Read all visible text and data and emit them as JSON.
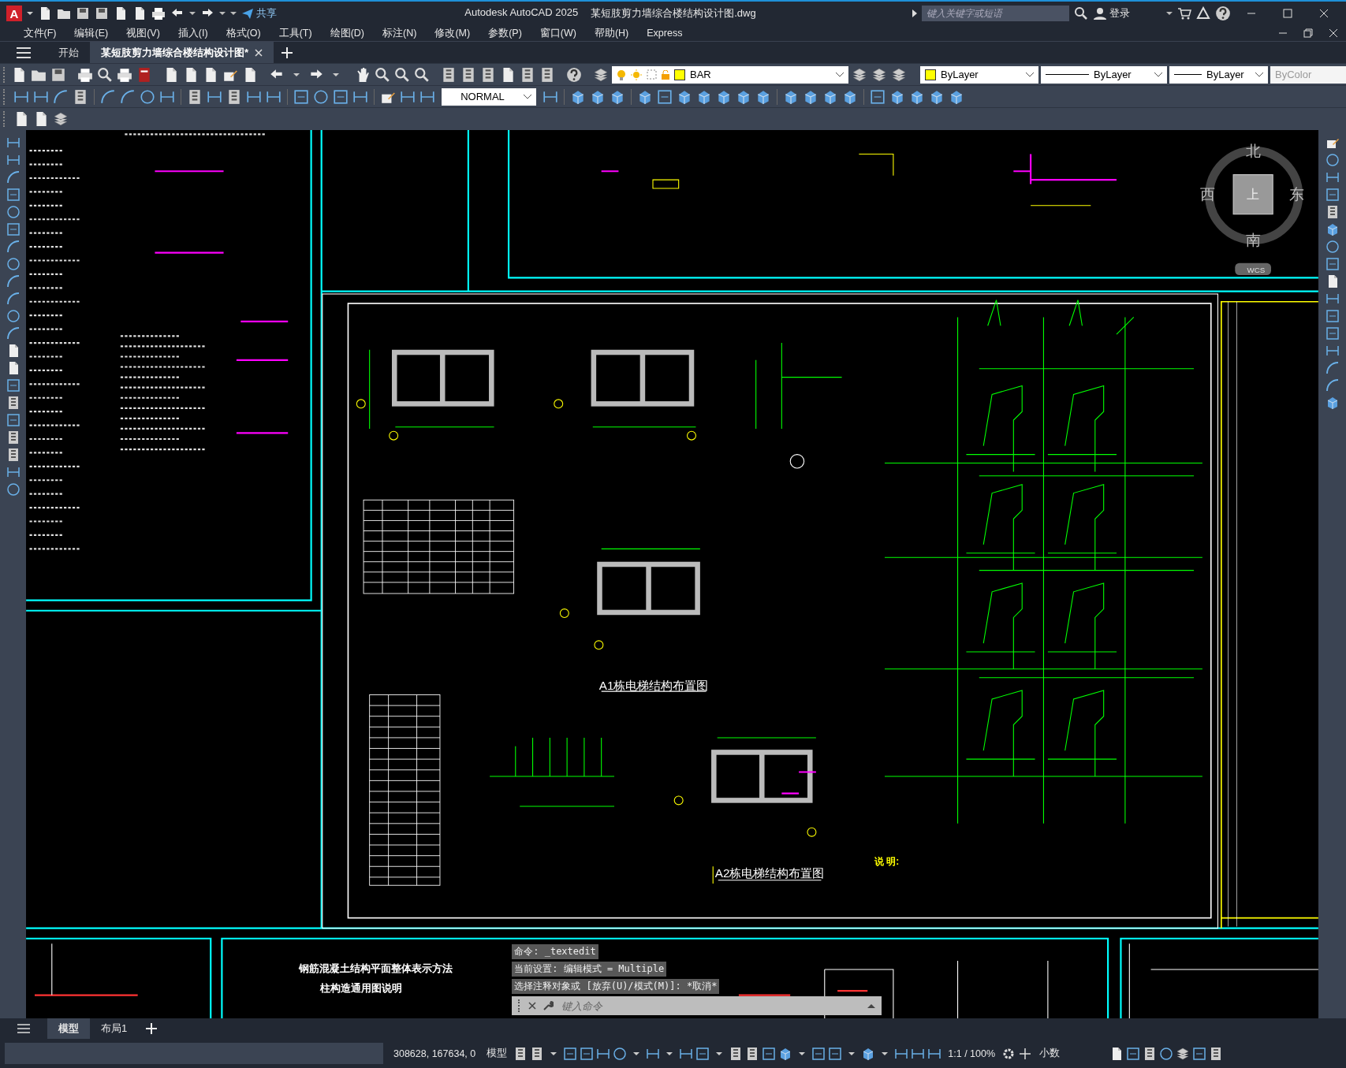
{
  "title_bar": {
    "logo": "A",
    "share": "共享",
    "app_name": "Autodesk AutoCAD 2025",
    "file_name": "某短肢剪力墙综合楼结构设计图.dwg",
    "search": {
      "placeholder": "键入关键字或短语"
    },
    "sign_in": "登录"
  },
  "menu": [
    "文件(F)",
    "编辑(E)",
    "视图(V)",
    "插入(I)",
    "格式(O)",
    "工具(T)",
    "绘图(D)",
    "标注(N)",
    "修改(M)",
    "参数(P)",
    "窗口(W)",
    "帮助(H)",
    "Express"
  ],
  "file_tabs": [
    {
      "label": "开始",
      "selected": false
    },
    {
      "label": "某短肢剪力墙综合楼结构设计图*",
      "selected": true
    }
  ],
  "toolbar": {
    "layer": "BAR",
    "dim_style": "NORMAL",
    "object_color": "ByLayer",
    "linetype": "ByLayer",
    "lineweight": "ByLayer",
    "plot_style": {
      "value": "ByColor",
      "disabled": true
    }
  },
  "drawing": {
    "titles": [
      "A1栋电梯结构布置图",
      "A2栋电梯结构布置图"
    ],
    "notes_heading": "说 明:",
    "bottom_titles": [
      "钢筋混凝土结构平面整体表示方法",
      "柱构造通用图说明"
    ]
  },
  "viewcube": {
    "north": "北",
    "south": "南",
    "west": "西",
    "east": "东",
    "top": "上",
    "ucs": "WCS"
  },
  "command_line": {
    "history": [
      "命令:  _textedit",
      "当前设置: 编辑模式 = Multiple",
      "选择注释对象或 [放弃(U)/模式(M)]: *取消*"
    ],
    "placeholder": "键入命令"
  },
  "layout_tabs": [
    {
      "label": "模型",
      "selected": true
    },
    {
      "label": "布局1",
      "selected": false
    }
  ],
  "status_bar": {
    "coordinates": "308628, 167634, 0",
    "space": "模型",
    "scale": "1:1 / 100%",
    "units": "小数"
  }
}
